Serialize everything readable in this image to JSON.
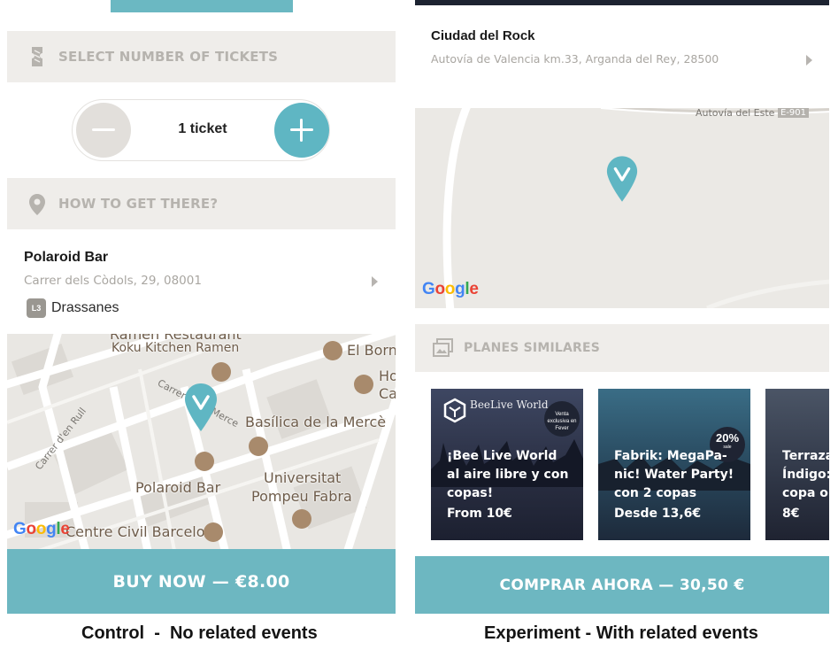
{
  "control": {
    "tickets_header": "SELECT NUMBER OF TICKETS",
    "stepper": {
      "count_label": "1 ticket"
    },
    "howto_header": "HOW TO GET THERE?",
    "venue": {
      "name": "Polaroid Bar",
      "address": "Carrer dels Còdols, 29, 08001",
      "metro_line": "L3",
      "metro_station": "Drassanes"
    },
    "map": {
      "labels": [
        "Ramen Restaurant",
        "Koku Kitchen Ramen",
        "El Born",
        "Ho",
        "Ca",
        "Basílica de la Mercè",
        "Polaroid Bar",
        "Universitat",
        "Pompeu Fabra",
        "Centre Civil Barcelona"
      ],
      "streets": [
        "Carrer d'en Rull",
        "Carrer de la Merce",
        "rra"
      ],
      "logo": "Google"
    },
    "cta": "BUY NOW — €8.00",
    "caption": "Control  -  No related events"
  },
  "experiment": {
    "venue": {
      "name": "Ciudad del Rock",
      "address": "Autovía de Valencia km.33, Arganda del Rey, 28500"
    },
    "map": {
      "road_label": "Autovía del Este",
      "road_code": "E-901",
      "logo": "Google"
    },
    "similar_header": "PLANES SIMILARES",
    "cards": [
      {
        "brand": "BeeLive World",
        "stamp": "Venta exclusiva en Fever",
        "title": "¡Bee Live World al aire libre y con copas!",
        "price": "From 10€"
      },
      {
        "discount": "20%",
        "discount_sub": "sale",
        "title": "Fabrik: MegaPa-nic! Water Party! con 2 copas",
        "price": "Desde 13,6€"
      },
      {
        "title": "Terraza Índigo: copa o",
        "price": "8€"
      }
    ],
    "cta": "COMPRAR AHORA — 30,50 €",
    "caption": "Experiment - With related events"
  },
  "colors": {
    "teal": "#6db7c1",
    "header_bg": "#efedea",
    "pin": "#5fb6c3"
  }
}
